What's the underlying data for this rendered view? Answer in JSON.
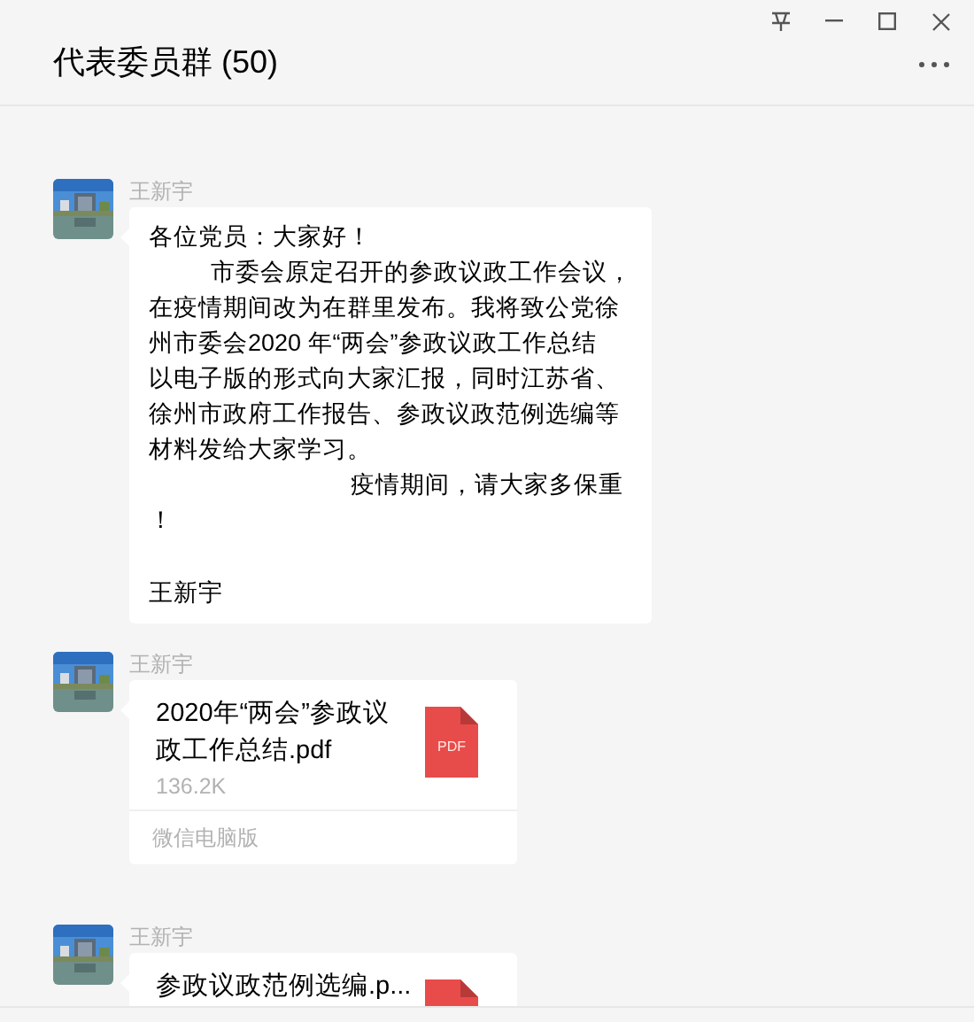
{
  "window": {
    "title": "代表委员群 (50)"
  },
  "messages": [
    {
      "kind": "text",
      "sender": "王新宇",
      "lines": [
        {
          "kind": "plain",
          "text": "各位党员：大家好！"
        },
        {
          "kind": "indent",
          "text": "市委会原定召开的参政议政工作会议，"
        },
        {
          "kind": "plain",
          "text": "在疫情期间改为在群里发布。我将致公党徐"
        },
        {
          "kind": "plain",
          "text": "州市委会2020 年“两会”参政议政工作总结"
        },
        {
          "kind": "plain",
          "text": "以电子版的形式向大家汇报，同时江苏省、"
        },
        {
          "kind": "plain",
          "text": "徐州市政府工作报告、参政议政范例选编等"
        },
        {
          "kind": "plain",
          "text": "材料发给大家学习。"
        },
        {
          "kind": "wide-indent",
          "text": "疫情期间，请大家多保重"
        },
        {
          "kind": "plain",
          "text": "！"
        },
        {
          "kind": "gap"
        },
        {
          "kind": "plain",
          "text": "王新宇"
        }
      ]
    },
    {
      "kind": "file",
      "sender": "王新宇",
      "filename": "2020年“两会”参政议政工作总结.pdf",
      "size": "136.2K",
      "icon_label": "PDF",
      "source": "微信电脑版"
    },
    {
      "kind": "file",
      "sender": "王新宇",
      "filename": "参政议政范例选编.p..."
    }
  ]
}
